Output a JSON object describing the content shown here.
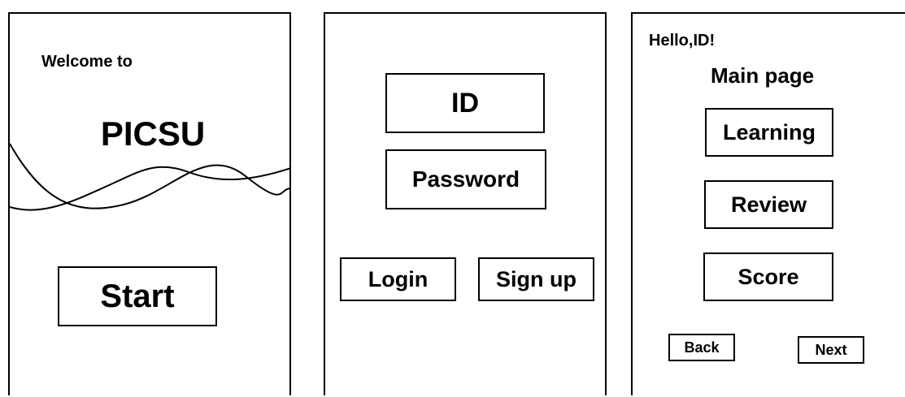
{
  "screen1": {
    "welcome": "Welcome to",
    "app_name": "PICSU",
    "start_label": "Start"
  },
  "screen2": {
    "id_field": "ID",
    "password_field": "Password",
    "login_label": "Login",
    "signup_label": "Sign up"
  },
  "screen3": {
    "greeting": "Hello,ID!",
    "title": "Main page",
    "learning_label": "Learning",
    "review_label": "Review",
    "score_label": "Score",
    "back_label": "Back",
    "next_label": "Next"
  }
}
